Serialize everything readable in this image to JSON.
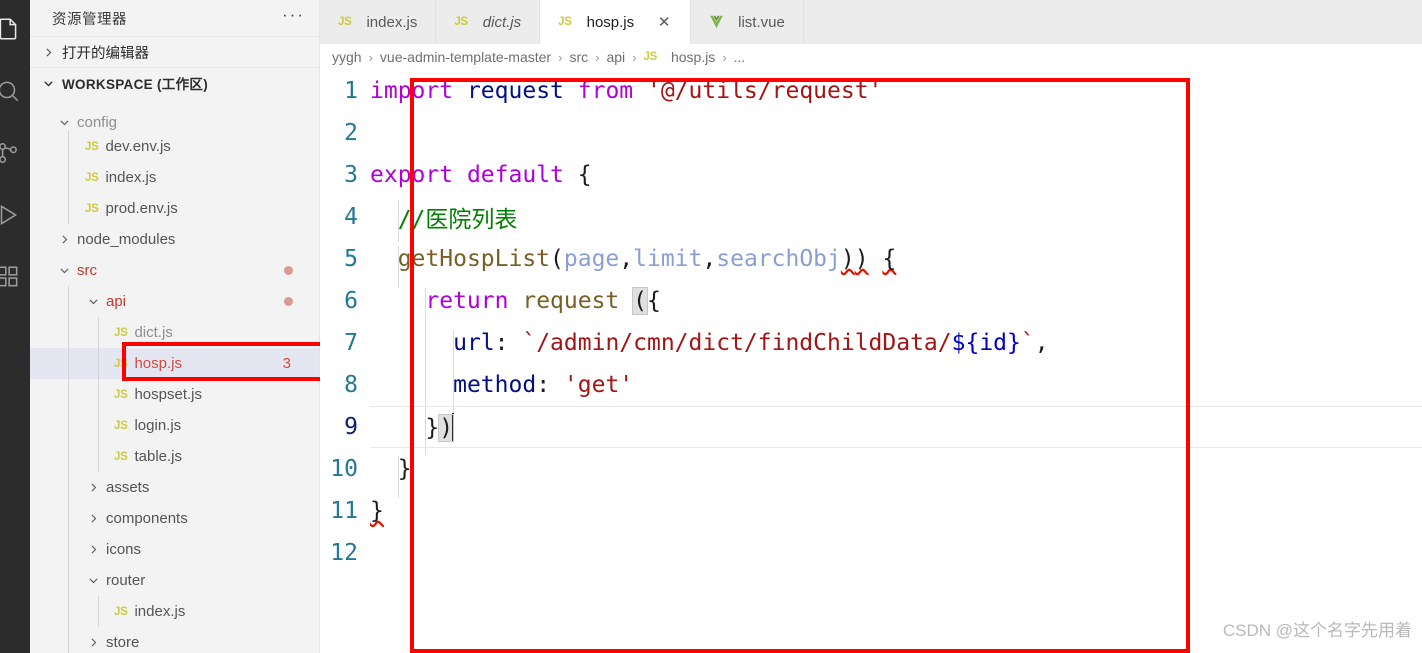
{
  "activity_bar": {
    "icons": [
      {
        "name": "explorer-icon",
        "glyph": "files"
      },
      {
        "name": "search-icon",
        "glyph": "magnifier"
      },
      {
        "name": "source-control-icon",
        "glyph": "branch"
      },
      {
        "name": "run-debug-icon",
        "glyph": "play"
      },
      {
        "name": "extensions-icon",
        "glyph": "blocks"
      }
    ]
  },
  "sidebar": {
    "title": "资源管理器",
    "more_actions": "···",
    "open_editors": "打开的编辑器",
    "workspace": "WORKSPACE (工作区)",
    "tree": [
      {
        "label": "config",
        "kind": "folder",
        "indent": 1,
        "expanded": true,
        "clipped": true,
        "badge": "",
        "dot": false,
        "state": ""
      },
      {
        "label": "dev.env.js",
        "kind": "js",
        "indent": 2,
        "expanded": null,
        "clipped": false,
        "badge": "",
        "dot": false,
        "state": ""
      },
      {
        "label": "index.js",
        "kind": "js",
        "indent": 2,
        "expanded": null,
        "clipped": false,
        "badge": "",
        "dot": false,
        "state": ""
      },
      {
        "label": "prod.env.js",
        "kind": "js",
        "indent": 2,
        "expanded": null,
        "clipped": false,
        "badge": "",
        "dot": false,
        "state": ""
      },
      {
        "label": "node_modules",
        "kind": "folder",
        "indent": 1,
        "expanded": false,
        "clipped": false,
        "badge": "",
        "dot": false,
        "state": ""
      },
      {
        "label": "src",
        "kind": "folder",
        "indent": 1,
        "expanded": true,
        "clipped": false,
        "badge": "",
        "dot": true,
        "state": "modified"
      },
      {
        "label": "api",
        "kind": "folder",
        "indent": 2,
        "expanded": true,
        "clipped": false,
        "badge": "",
        "dot": true,
        "state": "modified"
      },
      {
        "label": "dict.js",
        "kind": "js",
        "indent": 3,
        "expanded": null,
        "clipped": true,
        "badge": "",
        "dot": false,
        "state": ""
      },
      {
        "label": "hosp.js",
        "kind": "js",
        "indent": 3,
        "expanded": null,
        "clipped": false,
        "badge": "3",
        "dot": false,
        "state": "error",
        "selected": true
      },
      {
        "label": "hospset.js",
        "kind": "js",
        "indent": 3,
        "expanded": null,
        "clipped": false,
        "badge": "",
        "dot": false,
        "state": ""
      },
      {
        "label": "login.js",
        "kind": "js",
        "indent": 3,
        "expanded": null,
        "clipped": false,
        "badge": "",
        "dot": false,
        "state": ""
      },
      {
        "label": "table.js",
        "kind": "js",
        "indent": 3,
        "expanded": null,
        "clipped": false,
        "badge": "",
        "dot": false,
        "state": ""
      },
      {
        "label": "assets",
        "kind": "folder",
        "indent": 2,
        "expanded": false,
        "clipped": false,
        "badge": "",
        "dot": false,
        "state": ""
      },
      {
        "label": "components",
        "kind": "folder",
        "indent": 2,
        "expanded": false,
        "clipped": false,
        "badge": "",
        "dot": false,
        "state": ""
      },
      {
        "label": "icons",
        "kind": "folder",
        "indent": 2,
        "expanded": false,
        "clipped": false,
        "badge": "",
        "dot": false,
        "state": ""
      },
      {
        "label": "router",
        "kind": "folder",
        "indent": 2,
        "expanded": true,
        "clipped": false,
        "badge": "",
        "dot": false,
        "state": ""
      },
      {
        "label": "index.js",
        "kind": "js",
        "indent": 3,
        "expanded": null,
        "clipped": false,
        "badge": "",
        "dot": false,
        "state": ""
      },
      {
        "label": "store",
        "kind": "folder",
        "indent": 2,
        "expanded": false,
        "clipped": false,
        "badge": "",
        "dot": false,
        "state": ""
      }
    ]
  },
  "tabs": [
    {
      "label": "index.js",
      "icon": "js",
      "active": false,
      "preview": false,
      "closable": false
    },
    {
      "label": "dict.js",
      "icon": "js",
      "active": false,
      "preview": true,
      "closable": false
    },
    {
      "label": "hosp.js",
      "icon": "js",
      "active": true,
      "preview": false,
      "closable": true,
      "close": "✕"
    },
    {
      "label": "list.vue",
      "icon": "vue",
      "active": false,
      "preview": false,
      "closable": false
    }
  ],
  "breadcrumb": {
    "separator": "›",
    "items": [
      "yygh",
      "vue-admin-template-master",
      "src",
      "api",
      "hosp.js",
      "..."
    ],
    "file_icon_index": 4
  },
  "code": {
    "language": "javascript",
    "line_numbers": [
      "1",
      "2",
      "3",
      "4",
      "5",
      "6",
      "7",
      "8",
      "9",
      "10",
      "11",
      "12"
    ],
    "active_line": 9,
    "lines": [
      {
        "n": "1",
        "text": "import request from '@/utils/request'"
      },
      {
        "n": "2",
        "text": ""
      },
      {
        "n": "3",
        "text": "export default {"
      },
      {
        "n": "4",
        "text": "  //医院列表"
      },
      {
        "n": "5",
        "text": "  getHospList(page,limit,searchObj)) {"
      },
      {
        "n": "6",
        "text": "    return request ({"
      },
      {
        "n": "7",
        "text": "      url: `/admin/cmn/dict/findChildData/${id}`,"
      },
      {
        "n": "8",
        "text": "      method: 'get'"
      },
      {
        "n": "9",
        "text": "    })"
      },
      {
        "n": "10",
        "text": "  }"
      },
      {
        "n": "11",
        "text": "}"
      },
      {
        "n": "12",
        "text": ""
      }
    ]
  },
  "annotations": {
    "editor_box_color": "#fe0000",
    "sidebar_box_color": "#fe0000"
  },
  "watermark": "CSDN @这个名字先用着"
}
